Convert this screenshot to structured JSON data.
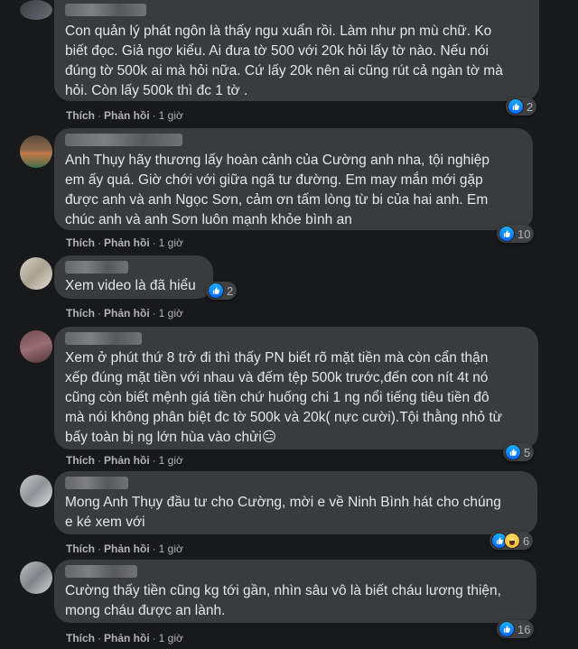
{
  "comments": [
    {
      "text": "Con quản lý phát ngôn là thấy ngu xuẩn rồi. Làm như pn mù chữ. Ko\nbiết đọc. Giả ngơ kiểu. Ai đưa tờ 500 với 20k hỏi lấy tờ nào. Nếu nói\nđúng tờ 500k ai mà hỏi nữa. Cứ lấy 20k nên ai cũng rút cả ngàn tờ mà\nhỏi. Còn lấy 500k thì đc 1 tờ .",
      "like": "Thích",
      "reply": "Phản hồi",
      "time": "1 giờ",
      "reactions": "2"
    },
    {
      "text": "Anh Thụy hãy thương lấy hoàn cảnh của Cường anh nha, tội nghiệp\nem ấy quá. Giờ chới với giữa ngã tư đường. Em may mắn mới gặp\nđược anh và anh Ngọc Sơn, cảm ơn tấm lòng từ bi của hai anh. Em\nchúc anh và anh Sơn luôn mạnh khỏe bình an",
      "like": "Thích",
      "reply": "Phản hồi",
      "time": "1 giờ",
      "reactions": "10"
    },
    {
      "text": "Xem video là đã hiểu",
      "like": "Thích",
      "reply": "Phản hồi",
      "time": "1 giờ",
      "reactions": "2"
    },
    {
      "text": "Xem ở phút thứ 8 trở đi thì thấy PN biết rõ mặt tiền mà còn cẩn thận\nxếp đúng mặt tiền với nhau và đếm tệp 500k trước,đến con nít 4t nó\ncũng còn biết mệnh giá tiền chứ huống chi 1 ng nổi tiếng tiêu tiền đô\nmà nói không phân biệt đc tờ 500k và 20k( nực cười).Tội thằng nhỏ từ\nbấy toàn bị ng lớn hùa vào chửi😑",
      "like": "Thích",
      "reply": "Phản hồi",
      "time": "1 giờ",
      "reactions": "5"
    },
    {
      "text": "Mong Anh Thụy đầu tư cho Cường, mời e về Ninh Bình hát cho chúng\ne ké xem với",
      "like": "Thích",
      "reply": "Phản hồi",
      "time": "1 giờ",
      "reactions": "6"
    },
    {
      "text": "Cường thấy tiền cũng kg tới gần, nhìn sâu vô là biết cháu lương thiện,\nmong cháu được an lành.",
      "like": "Thích",
      "reply": "Phản hồi",
      "time": "1 giờ",
      "reactions": "16"
    }
  ],
  "icons": {
    "like": "like-icon",
    "haha": "haha-icon"
  },
  "colors": {
    "background": "#18191a",
    "bubble": "#3a3b3c",
    "text": "#e4e6eb",
    "meta": "#b0b3b8",
    "like_blue": "#0866ff"
  }
}
